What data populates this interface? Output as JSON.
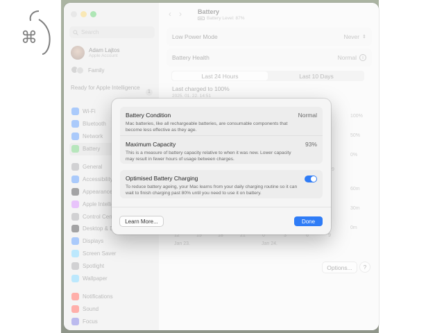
{
  "window": {
    "title": "Battery",
    "battery_level": "Battery Level: 87%"
  },
  "search": {
    "placeholder": "Search"
  },
  "account": {
    "name": "Adam Lajtos",
    "subtitle": "Apple Account"
  },
  "family": {
    "label": "Family"
  },
  "apple_intelligence": {
    "label": "Ready for Apple Intelligence",
    "badge": "1"
  },
  "sidebar": {
    "items": [
      {
        "label": "Wi-Fi",
        "icon": "wifi-icon",
        "color": "#2f7cf6"
      },
      {
        "label": "Bluetooth",
        "icon": "bluetooth-icon",
        "color": "#2f7cf6"
      },
      {
        "label": "Network",
        "icon": "network-icon",
        "color": "#2f7cf6"
      },
      {
        "label": "Battery",
        "icon": "battery-icon",
        "color": "#4fc25b"
      },
      {
        "label": "General",
        "icon": "gear-icon",
        "color": "#8e8e93"
      },
      {
        "label": "Accessibility",
        "icon": "accessibility-icon",
        "color": "#2f7cf6"
      },
      {
        "label": "Appearance",
        "icon": "appearance-icon",
        "color": "#1d1d1f"
      },
      {
        "label": "Apple Intelligence",
        "icon": "apple-intelligence-icon",
        "color": "#c86df5"
      },
      {
        "label": "Control Centre",
        "icon": "control-centre-icon",
        "color": "#8e8e93"
      },
      {
        "label": "Desktop & Dock",
        "icon": "desktop-dock-icon",
        "color": "#1d1d1f"
      },
      {
        "label": "Displays",
        "icon": "displays-icon",
        "color": "#2f7cf6"
      },
      {
        "label": "Screen Saver",
        "icon": "screen-saver-icon",
        "color": "#5ac8fa"
      },
      {
        "label": "Spotlight",
        "icon": "spotlight-icon",
        "color": "#8e8e93"
      },
      {
        "label": "Wallpaper",
        "icon": "wallpaper-icon",
        "color": "#5ac8fa"
      },
      {
        "label": "Notifications",
        "icon": "notifications-icon",
        "color": "#ff3b30"
      },
      {
        "label": "Sound",
        "icon": "sound-icon",
        "color": "#ff3b30"
      },
      {
        "label": "Focus",
        "icon": "focus-icon",
        "color": "#5856d6"
      }
    ]
  },
  "main": {
    "low_power_mode": {
      "label": "Low Power Mode",
      "value": "Never"
    },
    "battery_health": {
      "label": "Battery Health",
      "value": "Normal"
    },
    "tabs": [
      {
        "label": "Last 24 Hours"
      },
      {
        "label": "Last 10 Days"
      }
    ],
    "last_charged": {
      "label": "Last charged to 100%",
      "date": "2025. 01. 22. 14:51"
    },
    "chart_axis": {
      "top": [
        "100%",
        "50%",
        "0%"
      ],
      "bottom": [
        "60m",
        "30m",
        "0m"
      ],
      "x_dates": [
        "Jan 23.",
        "Jan 24."
      ],
      "x_ticks": [
        "12",
        "15",
        "18",
        "21",
        "0",
        "3",
        "6",
        "9"
      ],
      "upper_tick": "9"
    },
    "options_label": "Options...",
    "help_label": "?"
  },
  "dialog": {
    "battery_condition": {
      "title": "Battery Condition",
      "value": "Normal",
      "description": "Mac batteries, like all rechargeable batteries, are consumable components that become less effective as they age."
    },
    "maximum_capacity": {
      "title": "Maximum Capacity",
      "value": "93%",
      "description": "This is a measure of battery capacity relative to when it was new. Lower capacity may result in fewer hours of usage between charges."
    },
    "optimised_charging": {
      "title": "Optimised Battery Charging",
      "enabled": true,
      "description": "To reduce battery ageing, your Mac learns from your daily charging routine so it can wait to finish charging past 80% until you need to use it on battery."
    },
    "learn_more": "Learn More...",
    "done": "Done"
  }
}
